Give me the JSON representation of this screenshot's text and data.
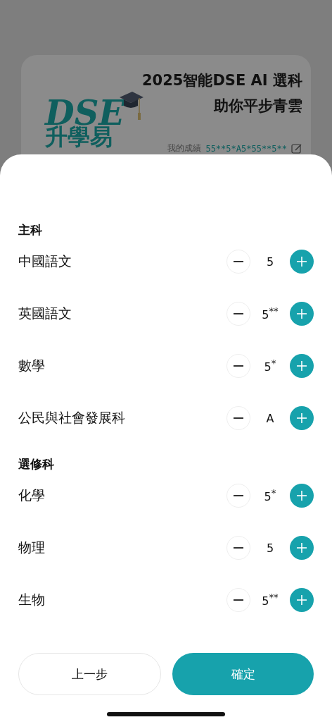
{
  "banner": {
    "logo_text": "DSE",
    "logo_subtitle": "升學易",
    "title_lines": [
      "2025智能DSE AI 選科",
      "助你平步青雲"
    ],
    "scores_label": "我的成績",
    "scores": "55**5*A5*55**5**"
  },
  "sections": [
    {
      "title": "主科",
      "subjects": [
        {
          "name": "中國語文",
          "grade": "5"
        },
        {
          "name": "英國語文",
          "grade": "5$^{**}$"
        },
        {
          "name": "數學",
          "grade": "5$^{*}$"
        },
        {
          "name": "公民與社會發展科",
          "grade": "A"
        }
      ]
    },
    {
      "title": "選修科",
      "subjects": [
        {
          "name": "化學",
          "grade": "5$^{*}$"
        },
        {
          "name": "物理",
          "grade": "5"
        },
        {
          "name": "生物",
          "grade": "5$^{**}$"
        }
      ]
    }
  ],
  "buttons": [
    {
      "label": "上一步",
      "kind": "secondary"
    },
    {
      "label": "確定",
      "kind": "primary"
    }
  ]
}
